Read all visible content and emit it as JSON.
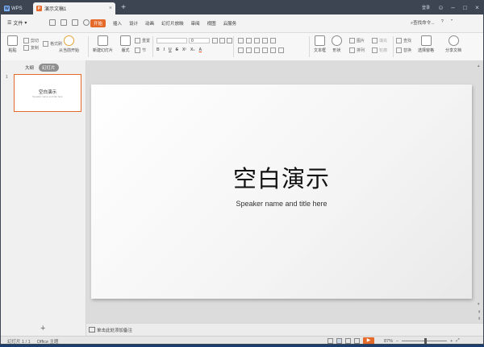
{
  "titlebar": {
    "app_tab": "WPS",
    "doc_tab": "演示文稿1",
    "login": "登录"
  },
  "menubar": {
    "file": "文件",
    "tabs": [
      "开始",
      "插入",
      "设计",
      "动画",
      "幻灯片放映",
      "审阅",
      "视图",
      "云服务"
    ],
    "active_tab": "开始",
    "search": "查找命令...",
    "accent_color": "#e56a2a"
  },
  "ribbon": {
    "paste": "粘贴",
    "cut": "剪切",
    "copy": "复制",
    "format_painter": "格式刷",
    "from_start": "从当前开始",
    "new_slide": "新建幻灯片",
    "layout": "版式",
    "reset": "重置",
    "section": "节",
    "font_size": "0",
    "textbox": "文本框",
    "shape": "形状",
    "picture": "图片",
    "arrange": "排列",
    "fill": "填充",
    "outline": "轮廓",
    "find": "查找",
    "replace": "替换",
    "selection_pane": "选择窗格",
    "share": "分享文档"
  },
  "leftpanel": {
    "tab_outline": "大纲",
    "tab_slides": "幻灯片",
    "slide_number": "1",
    "thumb_title": "空白演示",
    "thumb_sub": "Speaker name and title here"
  },
  "slide": {
    "title": "空白演示",
    "subtitle": "Speaker name and title here"
  },
  "notes": {
    "placeholder": "单击此处添加备注"
  },
  "statusbar": {
    "slide_info": "幻灯片 1 / 1",
    "theme": "Office 主题",
    "zoom": "87%"
  }
}
